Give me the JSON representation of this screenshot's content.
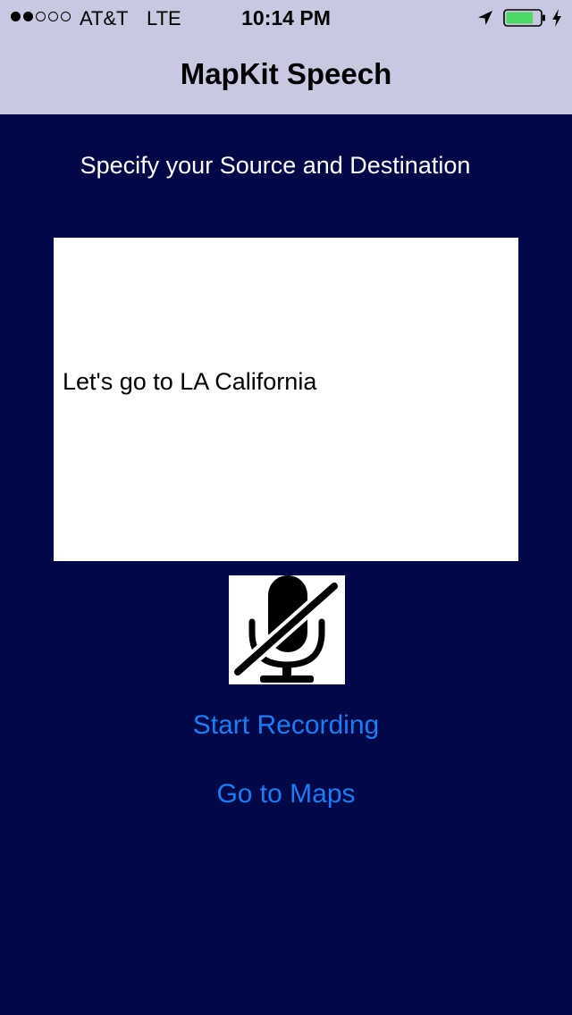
{
  "status_bar": {
    "signal_dots": [
      true,
      true,
      false,
      false,
      false
    ],
    "carrier": "AT&T",
    "network": "LTE",
    "time": "10:14 PM",
    "battery_level": 0.8,
    "battery_color": "#4cd964"
  },
  "nav": {
    "title": "MapKit Speech"
  },
  "main": {
    "instruction": "Specify your Source and Destination",
    "transcription": "Let's go to LA California",
    "mic_icon": "microphone-slash-icon",
    "start_recording_label": "Start Recording",
    "go_to_maps_label": "Go to Maps"
  },
  "colors": {
    "background": "#000848",
    "nav_background": "#c8c9e0",
    "link": "#1a7cf7"
  }
}
